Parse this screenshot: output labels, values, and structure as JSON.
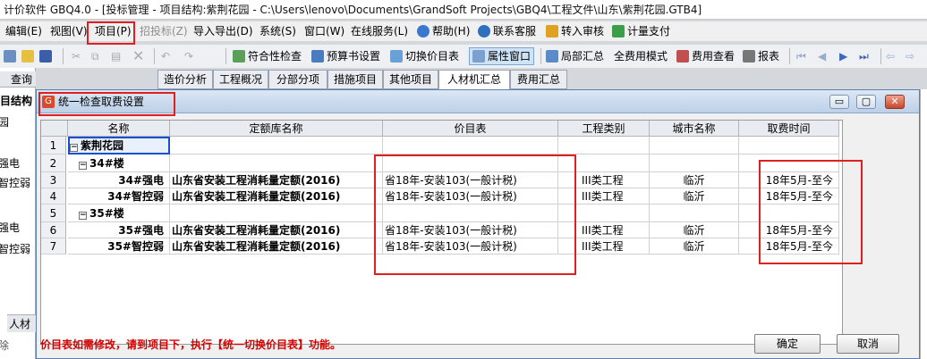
{
  "window": {
    "title": "计价软件 GBQ4.0 - [投标管理 - 项目结构:紫荆花园 - C:\\Users\\lenovo\\Documents\\GrandSoft Projects\\GBQ4\\工程文件\\山东\\紫荆花园.GTB4]"
  },
  "menu": {
    "items": [
      "编辑(E)",
      "视图(V)",
      "项目(P)",
      "招投标(Z)",
      "导入导出(D)",
      "系统(S)",
      "窗口(W)",
      "在线服务(L)",
      "帮助(H)",
      "联系客服",
      "转入审核",
      "计量支付"
    ]
  },
  "toolbar": {
    "buttons": [
      "符合性检查",
      "预算书设置",
      "切换价目表",
      "属性窗口",
      "局部汇总",
      "费用查看",
      "报表"
    ],
    "full_mode": "全费用模式"
  },
  "left_panel": {
    "query_label": "查询",
    "items": [
      "项目结构",
      "园",
      "强电",
      "智控弱",
      "强电",
      "智控弱"
    ],
    "bottom_tab": "人材",
    "bottom_item": "除"
  },
  "tabs": [
    "造价分析",
    "工程概况",
    "分部分项",
    "措施项目",
    "其他项目",
    "人材机汇总",
    "费用汇总"
  ],
  "dialog": {
    "title": "统一检查取费设置",
    "minimize": "▭",
    "restore": "▢",
    "close": "✕",
    "columns": [
      "名称",
      "定额库名称",
      "价目表",
      "工程类别",
      "城市名称",
      "取费时间"
    ],
    "rows": [
      {
        "num": "1",
        "name": "紫荆花园",
        "lib": "",
        "price": "",
        "cat": "",
        "city": "",
        "time": ""
      },
      {
        "num": "2",
        "name": "34#楼",
        "lib": "",
        "price": "",
        "cat": "",
        "city": "",
        "time": ""
      },
      {
        "num": "3",
        "name": "34#强电",
        "lib": "山东省安装工程消耗量定额(2016)",
        "price": "省18年-安装103(一般计税)",
        "cat": "III类工程",
        "city": "临沂",
        "time": "18年5月-至今"
      },
      {
        "num": "4",
        "name": "34#智控弱",
        "lib": "山东省安装工程消耗量定额(2016)",
        "price": "省18年-安装103(一般计税)",
        "cat": "III类工程",
        "city": "临沂",
        "time": "18年5月-至今"
      },
      {
        "num": "5",
        "name": "35#楼",
        "lib": "",
        "price": "",
        "cat": "",
        "city": "",
        "time": ""
      },
      {
        "num": "6",
        "name": "35#强电",
        "lib": "山东省安装工程消耗量定额(2016)",
        "price": "省18年-安装103(一般计税)",
        "cat": "III类工程",
        "city": "临沂",
        "time": "18年5月-至今"
      },
      {
        "num": "7",
        "name": "35#智控弱",
        "lib": "山东省安装工程消耗量定额(2016)",
        "price": "省18年-安装103(一般计税)",
        "cat": "III类工程",
        "city": "临沂",
        "time": "18年5月-至今"
      }
    ],
    "note": "价目表如需修改，请到项目下，执行【统一切换价目表】功能。",
    "ok": "确定",
    "cancel": "取消"
  }
}
